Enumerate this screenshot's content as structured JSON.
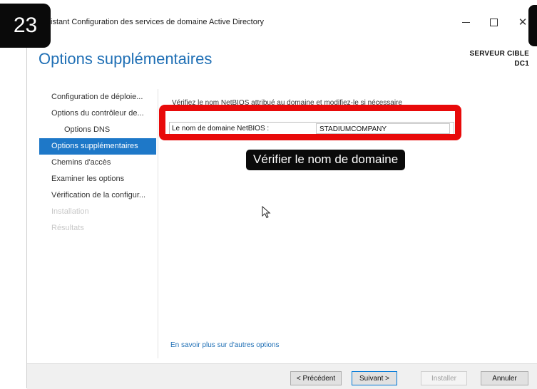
{
  "window": {
    "title": "ssistant Configuration des services de domaine Active Directory",
    "minimize_icon": "minimize-icon",
    "maximize_icon": "maximize-icon",
    "close_icon": "close-icon",
    "close_glyph": "✕"
  },
  "header": {
    "page_title": "Options supplémentaires",
    "target_server_label": "SERVEUR CIBLE",
    "target_server_name": "DC1"
  },
  "sidebar": {
    "items": [
      {
        "label": "Configuration de déploie...",
        "state": "normal"
      },
      {
        "label": "Options du contrôleur de...",
        "state": "normal"
      },
      {
        "label": "Options DNS",
        "state": "sub"
      },
      {
        "label": "Options supplémentaires",
        "state": "active"
      },
      {
        "label": "Chemins d'accès",
        "state": "normal"
      },
      {
        "label": "Examiner les options",
        "state": "normal"
      },
      {
        "label": "Vérification de la configur...",
        "state": "normal"
      },
      {
        "label": "Installation",
        "state": "disabled"
      },
      {
        "label": "Résultats",
        "state": "disabled"
      }
    ],
    "active_color": "#1e78c8"
  },
  "content": {
    "hint": "Vérifiez le nom NetBIOS attribué au domaine et modifiez-le si nécessaire",
    "netbios_label": "Le nom de domaine NetBIOS :",
    "netbios_value": "STADIUMCOMPANY",
    "more_link": "En savoir plus sur d'autres options"
  },
  "annotation": {
    "step_number": "23",
    "label": "Vérifier le nom de domaine",
    "highlight_color": "#e80a0a"
  },
  "footer": {
    "prev_label": "< Précédent",
    "next_label": "Suivant >",
    "install_label": "Installer",
    "cancel_label": "Annuler"
  },
  "colors": {
    "accent": "#1f6fb5"
  }
}
